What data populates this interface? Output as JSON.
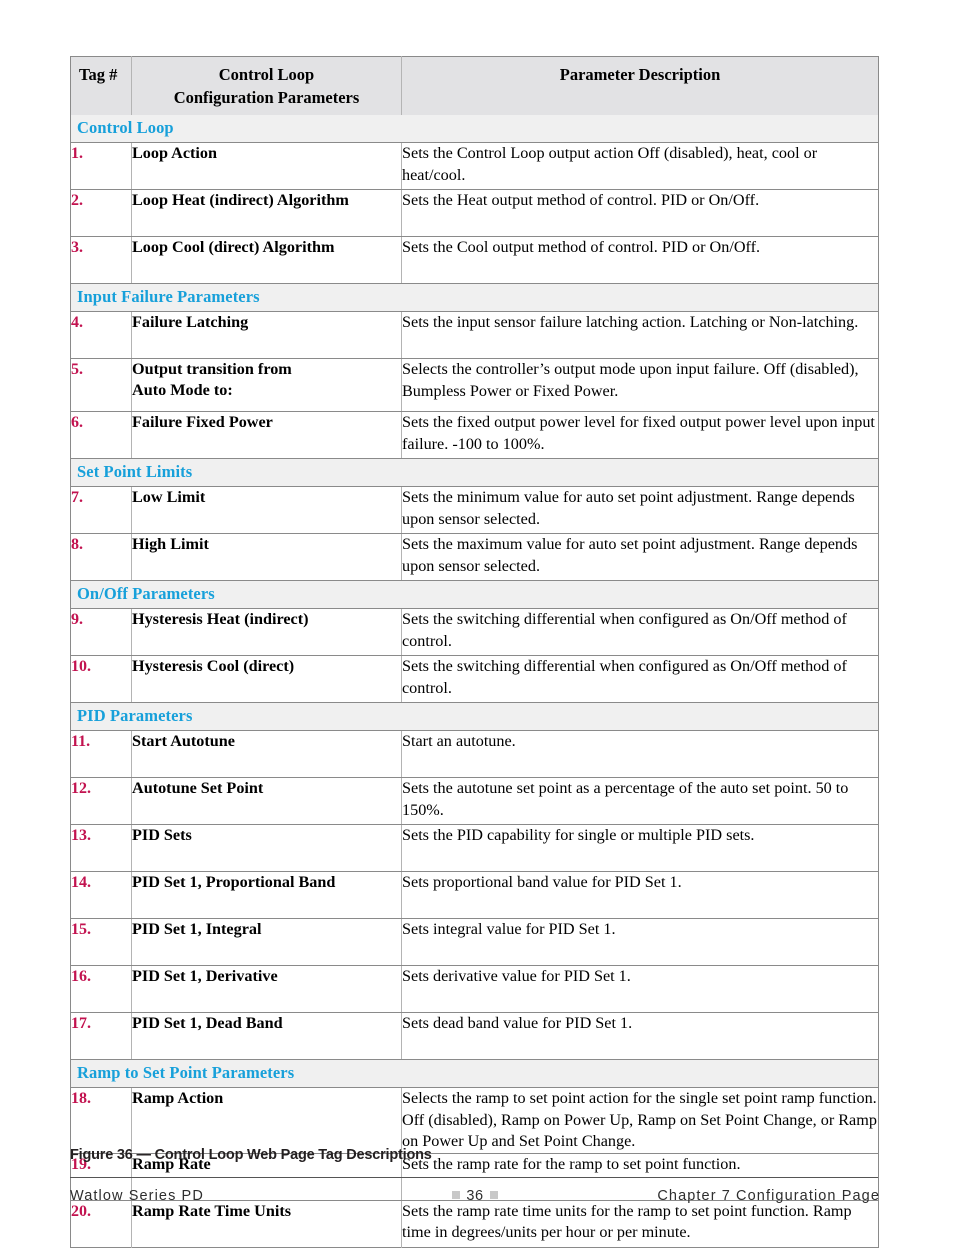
{
  "table": {
    "headers": {
      "tag": "Tag #",
      "param_line1": "Control Loop",
      "param_line2": "Configuration Parameters",
      "description": "Parameter Description"
    },
    "colors": {
      "section_header_text": "#17a0da",
      "tag_number_text": "#c2124f",
      "header_row_bg": "#e2e2e4",
      "section_row_bg": "#f0f0f0",
      "border": "#8a8a8a"
    },
    "sections": [
      {
        "label": "Control Loop",
        "rows": [
          {
            "tag": "1.",
            "param": "Loop Action",
            "param_line2": "",
            "description": "Sets the Control Loop output action  Off (disabled), heat, cool or heat/cool."
          },
          {
            "tag": "2.",
            "param": "Loop Heat (indirect) Algorithm",
            "param_line2": "",
            "description": "Sets the Heat output method of control. PID or On/Off."
          },
          {
            "tag": "3.",
            "param": "Loop Cool (direct) Algorithm",
            "param_line2": "",
            "description": "Sets the Cool output method of control. PID or On/Off."
          }
        ]
      },
      {
        "label": "Input Failure Parameters",
        "rows": [
          {
            "tag": "4.",
            "param": "Failure Latching",
            "param_line2": "",
            "description": "Sets the input sensor failure latching action. Latching or Non-latching."
          },
          {
            "tag": "5.",
            "param": "Output transition from",
            "param_line2": "Auto Mode to:",
            "description": "Selects the controller’s output mode upon input failure. Off (disabled), Bumpless Power or Fixed Power."
          },
          {
            "tag": "6.",
            "param": "Failure Fixed Power",
            "param_line2": "",
            "description": "Sets the fixed output power level for fixed output power level upon input failure. -100 to 100%."
          }
        ]
      },
      {
        "label": "Set Point Limits",
        "rows": [
          {
            "tag": "7.",
            "param": "Low Limit",
            "param_line2": "",
            "description": "Sets the minimum value for auto set point  adjustment. Range depends upon sensor selected."
          },
          {
            "tag": "8.",
            "param": "High Limit",
            "param_line2": "",
            "description": "Sets the maximum value for auto set point  adjustment. Range depends upon sensor selected."
          }
        ]
      },
      {
        "label": "On/Off Parameters",
        "rows": [
          {
            "tag": "9.",
            "param": "Hysteresis Heat (indirect)",
            "param_line2": "",
            "description": "Sets the switching differential when configured as On/Off method of control."
          },
          {
            "tag": "10.",
            "param": "Hysteresis Cool (direct)",
            "param_line2": "",
            "description": "Sets the switching differential when configured as On/Off method of control."
          }
        ]
      },
      {
        "label": "PID Parameters",
        "rows": [
          {
            "tag": "11.",
            "param": "Start Autotune",
            "param_line2": "",
            "description": "Start an autotune."
          },
          {
            "tag": "12.",
            "param": "Autotune Set Point",
            "param_line2": "",
            "description": "Sets the autotune set point as a percentage of the auto set point. 50 to 150%."
          },
          {
            "tag": "13.",
            "param": "PID Sets",
            "param_line2": "",
            "description": "Sets the PID capability for single or multiple PID sets."
          },
          {
            "tag": "14.",
            "param": "PID Set 1, Proportional Band",
            "param_line2": "",
            "description": "Sets proportional band value for PID Set 1."
          },
          {
            "tag": "15.",
            "param": "PID Set 1, Integral",
            "param_line2": "",
            "description": "Sets integral value for PID Set 1."
          },
          {
            "tag": "16.",
            "param": "PID Set 1, Derivative",
            "param_line2": "",
            "description": "Sets derivative value for PID Set 1."
          },
          {
            "tag": "17.",
            "param": "PID Set 1, Dead Band",
            "param_line2": "",
            "description": "Sets dead band value for PID Set 1."
          }
        ]
      },
      {
        "label": "Ramp to Set Point Parameters",
        "rows": [
          {
            "tag": "18.",
            "param": "Ramp Action",
            "param_line2": "",
            "description": "Selects the ramp to set point action for the single set point ramp function. Off (disabled), Ramp on Power Up, Ramp on Set Point Change, or Ramp on Power Up and Set Point Change."
          },
          {
            "tag": "19.",
            "param": "Ramp Rate",
            "param_line2": "",
            "description": "Sets the ramp rate for the ramp to set point function."
          },
          {
            "tag": "20.",
            "param": "Ramp Rate Time Units",
            "param_line2": "",
            "description": "Sets the ramp rate time units for the ramp to set point function. Ramp time in degrees/units per hour or per minute."
          }
        ]
      }
    ]
  },
  "caption": "Figure 36 — Control Loop Web Page Tag Descriptions",
  "footer": {
    "left": "Watlow Series PD",
    "page_number": "36",
    "right": "Chapter 7 Configuration Page"
  }
}
